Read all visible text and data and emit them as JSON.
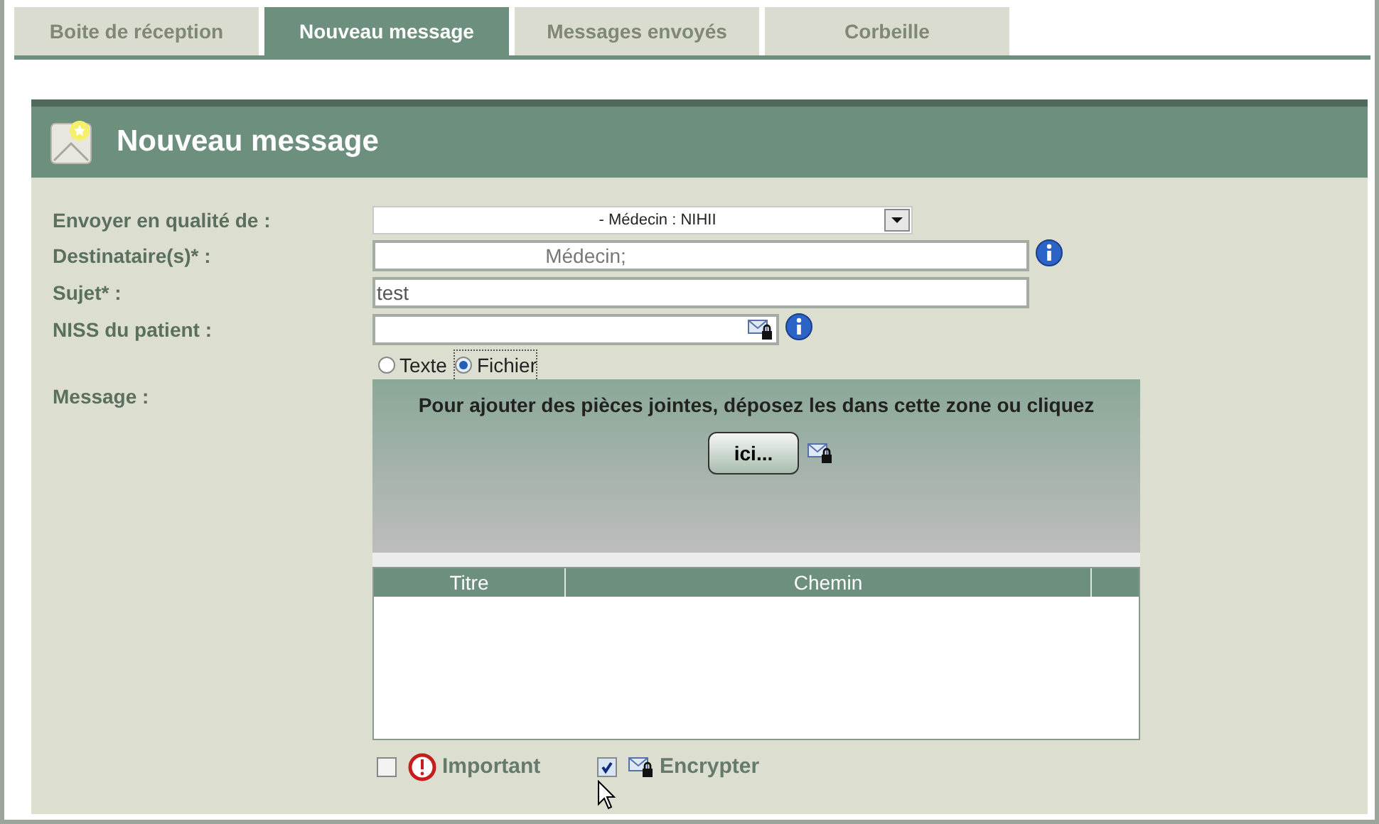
{
  "tabs": [
    {
      "label": "Boite de réception",
      "selected": false
    },
    {
      "label": "Nouveau message",
      "selected": true
    },
    {
      "label": "Messages envoyés",
      "selected": false
    },
    {
      "label": "Corbeille",
      "selected": false
    }
  ],
  "panel": {
    "title": "Nouveau message"
  },
  "form": {
    "sender": {
      "label": "Envoyer en qualité de :",
      "value": "- Médecin : NIHII"
    },
    "recipients": {
      "label": "Destinataire(s)* :",
      "value": "Médecin;"
    },
    "subject": {
      "label": "Sujet* :",
      "value": "test"
    },
    "niss": {
      "label": "NISS du patient :"
    },
    "message": {
      "label": "Message :",
      "options": [
        {
          "label": "Texte",
          "selected": false
        },
        {
          "label": "Fichier",
          "selected": true
        }
      ]
    }
  },
  "dropzone": {
    "instruction": "Pour ajouter des pièces jointes, déposez les dans cette zone ou cliquez",
    "button": "ici..."
  },
  "attachments": {
    "columns": [
      "Titre",
      "Chemin"
    ]
  },
  "flags": [
    {
      "kind": "important",
      "label": "Important",
      "checked": false
    },
    {
      "kind": "encrypt",
      "label": "Encrypter",
      "checked": true
    }
  ]
}
